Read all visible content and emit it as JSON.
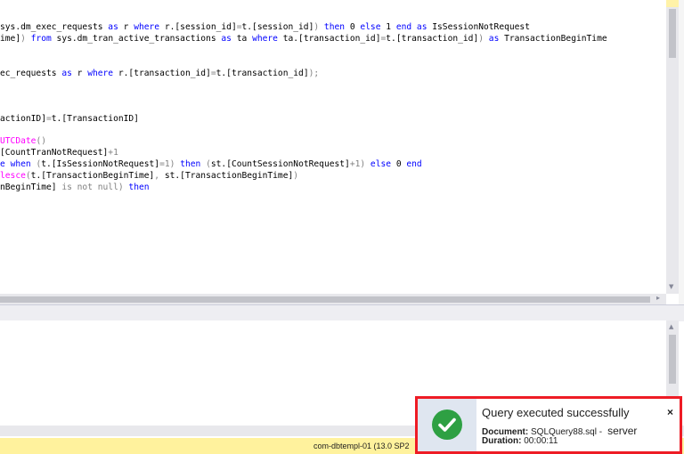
{
  "editor": {
    "line1": {
      "a": "sys.dm_exec_requests ",
      "b": "as",
      "c": " r ",
      "d": "where",
      "e": " r.[session_id]",
      "f": "=",
      "g": "t.[session_id]",
      "h": ")",
      "i": " then",
      "j": " 0 ",
      "k": "else",
      "l": " 1 ",
      "m": "end as",
      "n": " IsSessionNotRequest"
    },
    "line2": {
      "a": "ime]",
      "b": ")",
      "c": " from",
      "d": " sys.dm_tran_active_transactions ",
      "e": "as",
      "f": " ta ",
      "g": "where",
      "h": " ta.[transaction_id]",
      "i": "=",
      "j": "t.[transaction_id]",
      "k": ")",
      "l": " as",
      "m": " TransactionBeginTime"
    },
    "line3": {
      "a": "ec_requests ",
      "b": "as",
      "c": " r ",
      "d": "where",
      "e": " r.[transaction_id]",
      "f": "=",
      "g": "t.[transaction_id]",
      "h": ");"
    },
    "line4": {
      "a": "actionID]",
      "b": "=",
      "c": "t.[TransactionID]"
    },
    "line5": {
      "a": "UTCDate",
      "b": "()"
    },
    "line6": {
      "a": "[CountTranNotRequest]",
      "b": "+1"
    },
    "line7": {
      "a": "e ",
      "b": "when",
      "c": " (",
      "d": "t.[IsSessionNotRequest]",
      "e": "=1)",
      "f": " then",
      "g": " (",
      "h": "st.[CountSessionNotRequest]",
      "i": "+1)",
      "j": " else",
      "k": " 0 ",
      "l": "end"
    },
    "line8": {
      "a": "lesce",
      "b": "(",
      "c": "t.[TransactionBeginTime]",
      "d": ", ",
      "e": "st.[TransactionBeginTime]",
      "f": ")"
    },
    "line9": {
      "a": "nBeginTime]",
      "b": " is not null)",
      "c": " then"
    }
  },
  "status": {
    "server": "com-dbtempl-01 (13.0 SP2"
  },
  "toast": {
    "title": "Query executed successfully",
    "close": "×",
    "doc_label": "Document:",
    "doc_value": "SQLQuery88.sql -",
    "server": "server",
    "dur_label": "Duration:",
    "dur_value": "00:00:11",
    "icon": "check-circle-icon",
    "border_color": "#ee1c25",
    "success_color": "#2ea043"
  }
}
